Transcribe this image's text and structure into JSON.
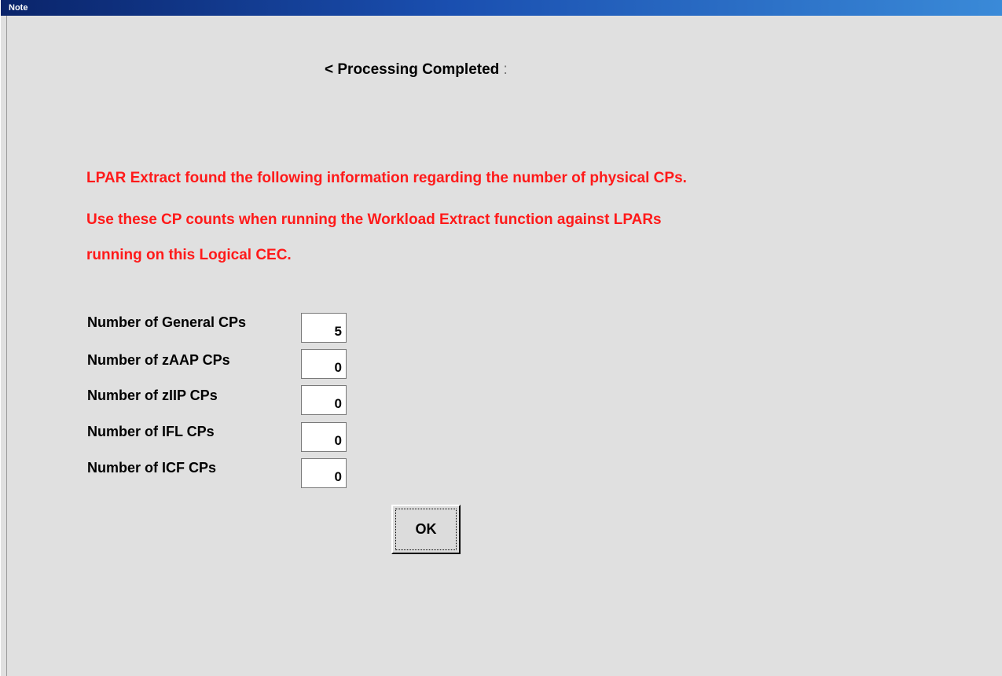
{
  "window": {
    "title": "Note"
  },
  "heading": {
    "text": "< Processing Completed",
    "tail": ":"
  },
  "message": {
    "line1": "LPAR Extract found the following information regarding the number of physical CPs.",
    "line2": "Use these CP counts when running the Workload Extract function against LPARs",
    "line3": "running on this Logical CEC.",
    "color": "#ff1a1a"
  },
  "fields": [
    {
      "label": "Number of General CPs",
      "value": "5"
    },
    {
      "label": "Number of zAAP CPs",
      "value": "0"
    },
    {
      "label": "Number of zIIP CPs",
      "value": "0"
    },
    {
      "label": "Number of IFL CPs",
      "value": "0"
    },
    {
      "label": "Number of ICF CPs",
      "value": "0"
    }
  ],
  "buttons": {
    "ok_label": "OK"
  },
  "colors": {
    "titlebar_start": "#0a246a",
    "titlebar_end": "#3a8ad8",
    "background": "#e0e0e0"
  }
}
